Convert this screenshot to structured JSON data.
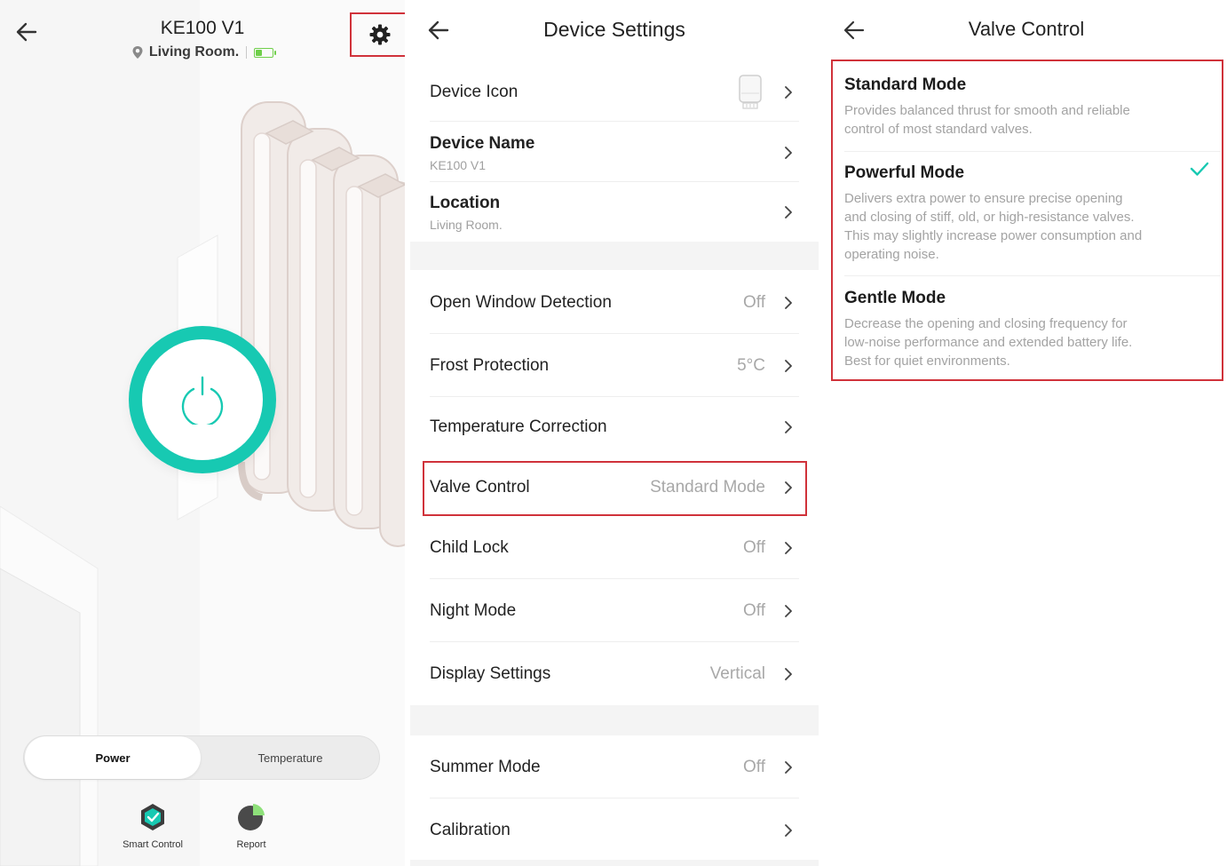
{
  "colors": {
    "accent": "#17c9b2",
    "highlight": "#d0323a",
    "battery": "#6fcf4a"
  },
  "device_panel": {
    "title": "KE100 V1",
    "location": "Living Room.",
    "battery_level": 0.4,
    "icons": {
      "back": "back-arrow-icon",
      "settings": "gear-icon",
      "location": "location-pin-icon",
      "power": "power-icon"
    },
    "tabs": [
      {
        "label": "Power",
        "active": true
      },
      {
        "label": "Temperature",
        "active": false
      }
    ],
    "bottom_items": [
      {
        "label": "Smart Control",
        "icon": "smart-control-icon"
      },
      {
        "label": "Report",
        "icon": "report-pie-icon"
      }
    ]
  },
  "settings_panel": {
    "title": "Device Settings",
    "device_icon_label": "Device Icon",
    "device_name": {
      "label": "Device Name",
      "value": "KE100 V1"
    },
    "location": {
      "label": "Location",
      "value": "Living Room."
    },
    "items": [
      {
        "label": "Open Window Detection",
        "value": "Off"
      },
      {
        "label": "Frost Protection",
        "value": "5°C"
      },
      {
        "label": "Temperature Correction",
        "value": ""
      },
      {
        "label": "Valve Control",
        "value": "Standard Mode"
      },
      {
        "label": "Child Lock",
        "value": "Off"
      },
      {
        "label": "Night Mode",
        "value": "Off"
      },
      {
        "label": "Display Settings",
        "value": "Vertical"
      }
    ],
    "items2": [
      {
        "label": "Summer Mode",
        "value": "Off"
      },
      {
        "label": "Calibration",
        "value": ""
      }
    ]
  },
  "valve_panel": {
    "title": "Valve Control",
    "selected": "Standard Mode",
    "modes": [
      {
        "name": "Standard Mode",
        "desc": [
          "Provides balanced thrust for smooth and reliable",
          "control of most standard valves."
        ]
      },
      {
        "name": "Powerful Mode",
        "desc": [
          "Delivers extra power to ensure precise opening",
          "and closing of stiff, old, or high-resistance valves.",
          "This may slightly increase power consumption and",
          "operating noise."
        ]
      },
      {
        "name": "Gentle Mode",
        "desc": [
          "Decrease the opening and closing frequency for",
          "low-noise performance and extended battery life.",
          "Best for quiet environments."
        ]
      }
    ]
  }
}
